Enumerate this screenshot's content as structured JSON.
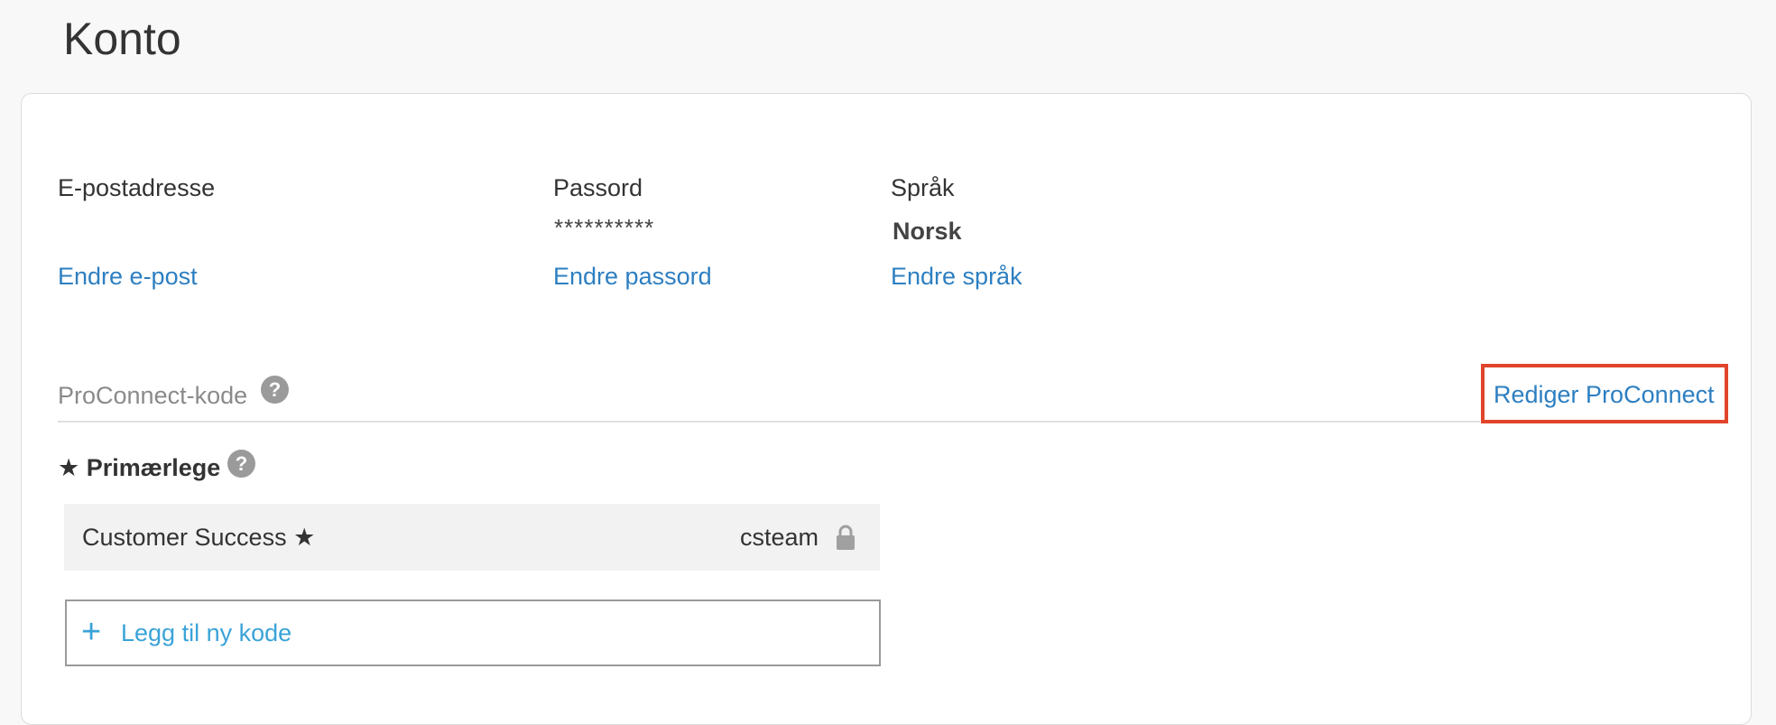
{
  "page": {
    "title": "Konto"
  },
  "account": {
    "email": {
      "label": "E-postadresse",
      "value": "",
      "change_link": "Endre e-post"
    },
    "password": {
      "label": "Passord",
      "value": "**********",
      "change_link": "Endre passord"
    },
    "language": {
      "label": "Språk",
      "value": "Norsk",
      "change_link": "Endre språk"
    }
  },
  "proconnect": {
    "label": "ProConnect-kode",
    "help_icon": "question-icon",
    "edit_link": "Rediger ProConnect",
    "highlight_color": "#e0452b",
    "primary": {
      "star": "★",
      "heading": "Primærlege",
      "help_icon": "question-icon"
    },
    "codes": [
      {
        "name": "Customer Success ★",
        "code": "csteam",
        "icon": "lock-icon"
      }
    ],
    "add": {
      "icon": "plus-icon",
      "label": "Legg til ny kode"
    }
  },
  "colors": {
    "link": "#2d7fc1",
    "add_link": "#3aa3d8",
    "highlight": "#e0452b"
  }
}
